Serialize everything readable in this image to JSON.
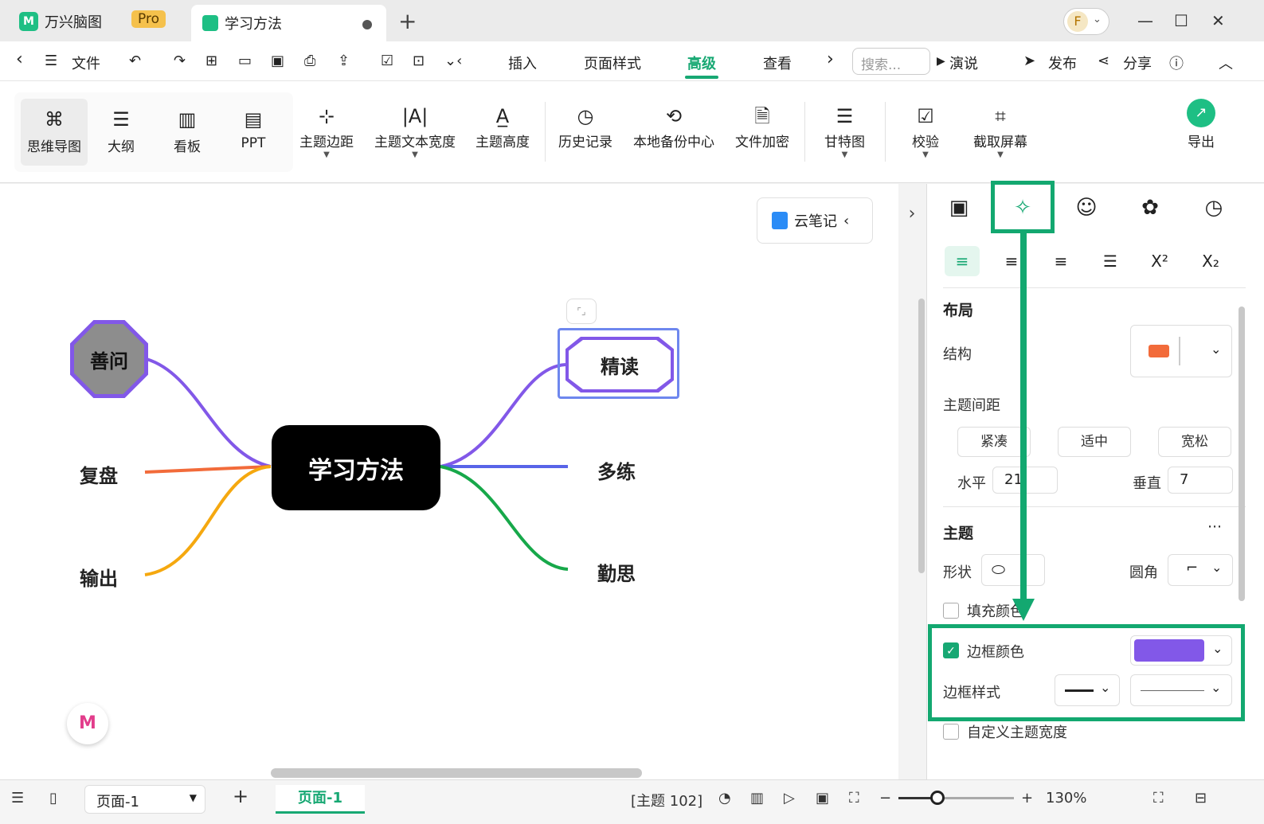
{
  "titlebar": {
    "app_name": "万兴脑图",
    "badge": "Pro",
    "doc_tab": "学习方法",
    "avatar_letter": "F"
  },
  "menubar": {
    "file": "文件",
    "tabs": [
      "插入",
      "页面样式",
      "高级",
      "查看"
    ],
    "active_tab": "高级",
    "search_placeholder": "搜索...",
    "present": "演说",
    "publish": "发布",
    "share": "分享"
  },
  "toolbar": {
    "views": [
      "思维导图",
      "大纲",
      "看板",
      "PPT"
    ],
    "tools": [
      "主题边距",
      "主题文本宽度",
      "主题高度",
      "历史记录",
      "本地备份中心",
      "文件加密",
      "甘特图",
      "校验",
      "截取屏幕"
    ],
    "export": "导出"
  },
  "canvas": {
    "cloud_note": "云笔记",
    "center": "学习方法",
    "branches": [
      "善问",
      "复盘",
      "输出",
      "精读",
      "多练",
      "勤思"
    ]
  },
  "panel": {
    "layout_header": "布局",
    "structure_label": "结构",
    "spacing_label": "主题间距",
    "spacing_options": [
      "紧凑",
      "适中",
      "宽松"
    ],
    "horizontal_label": "水平",
    "horizontal_value": "21",
    "vertical_label": "垂直",
    "vertical_value": "7",
    "topic_header": "主题",
    "shape_label": "形状",
    "corner_label": "圆角",
    "fill_label": "填充颜色",
    "border_color_label": "边框颜色",
    "border_style_label": "边框样式",
    "custom_width_label": "自定义主题宽度",
    "border_color": "#8258e8"
  },
  "status": {
    "page_select": "页面-1",
    "page_tab": "页面-1",
    "topic_count": "[主题 102]",
    "zoom": "130%"
  }
}
